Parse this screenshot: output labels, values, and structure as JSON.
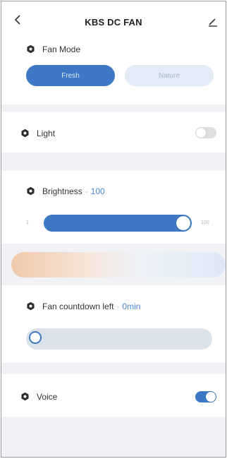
{
  "header": {
    "title": "KBS DC FAN",
    "back_icon": "chevron-left-icon",
    "edit_icon": "pencil-icon"
  },
  "fan_mode": {
    "label": "Fan Mode",
    "options": [
      "Fresh",
      "Nature"
    ],
    "selected": "Fresh"
  },
  "light": {
    "label": "Light",
    "enabled": false
  },
  "brightness": {
    "label": "Brightness",
    "value": "100",
    "min_label": "1",
    "max_label": "100",
    "level": 100
  },
  "countdown": {
    "label": "Fan countdown left",
    "value": "0min",
    "level": 0
  },
  "voice": {
    "label": "Voice",
    "enabled": true
  },
  "colors": {
    "accent": "#3d79c4",
    "accent_text": "#4a86c8",
    "background": "#f1f2f6",
    "gradient_warm": "#f1c9a9",
    "gradient_cool": "#dde8f5"
  }
}
